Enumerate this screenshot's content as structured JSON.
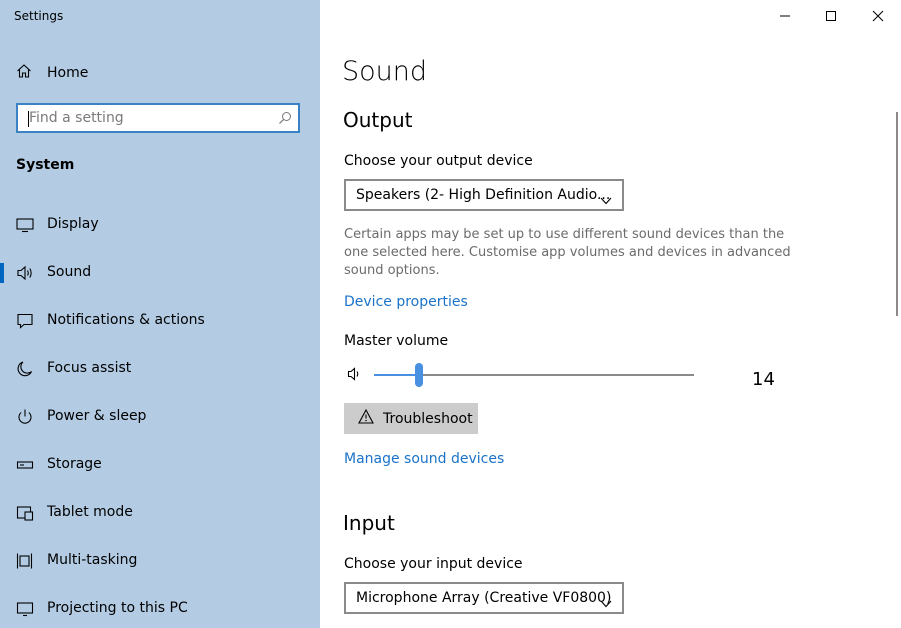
{
  "window": {
    "title": "Settings"
  },
  "sidebar": {
    "home_label": "Home",
    "search_placeholder": "Find a setting",
    "section_title": "System",
    "items": [
      {
        "label": "Display",
        "icon": "monitor-icon",
        "selected": false
      },
      {
        "label": "Sound",
        "icon": "speaker-icon",
        "selected": true
      },
      {
        "label": "Notifications & actions",
        "icon": "notification-icon",
        "selected": false
      },
      {
        "label": "Focus assist",
        "icon": "moon-icon",
        "selected": false
      },
      {
        "label": "Power & sleep",
        "icon": "power-icon",
        "selected": false
      },
      {
        "label": "Storage",
        "icon": "storage-icon",
        "selected": false
      },
      {
        "label": "Tablet mode",
        "icon": "tablet-icon",
        "selected": false
      },
      {
        "label": "Multi-tasking",
        "icon": "multitasking-icon",
        "selected": false
      },
      {
        "label": "Projecting to this PC",
        "icon": "projector-icon",
        "selected": false
      }
    ]
  },
  "main": {
    "title": "Sound",
    "output": {
      "heading": "Output",
      "device_label": "Choose your output device",
      "device_value": "Speakers (2- High Definition Audio...",
      "description": "Certain apps may be set up to use different sound devices than the one selected here. Customise app volumes and devices in advanced sound options.",
      "device_properties_link": "Device properties",
      "master_volume_label": "Master volume",
      "volume_value": "14",
      "troubleshoot_label": "Troubleshoot",
      "manage_link": "Manage sound devices"
    },
    "input": {
      "heading": "Input",
      "device_label": "Choose your input device",
      "device_value": "Microphone Array (Creative VF0800)"
    }
  },
  "colors": {
    "sidebar_bg": "#b3cce4",
    "accent": "#0067c0",
    "link": "#1a73c8",
    "slider": "#4a90e2"
  }
}
